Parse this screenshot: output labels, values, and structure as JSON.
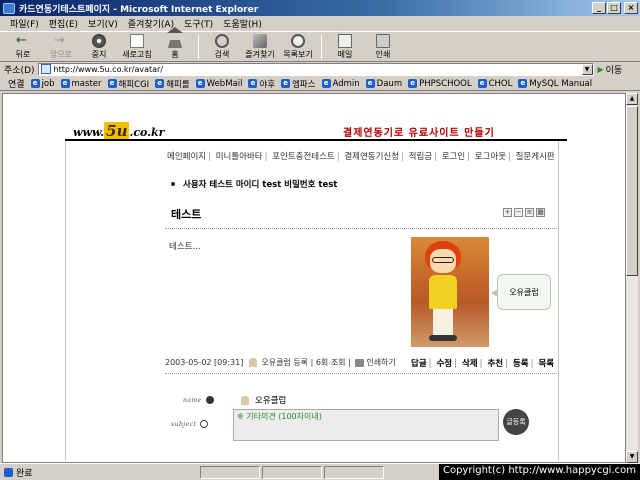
{
  "window": {
    "title": "카드연동기테스트페이지 - Microsoft Internet Explorer",
    "controls": {
      "minimize": "_",
      "maximize": "□",
      "close": "×"
    }
  },
  "menu": [
    "파일(F)",
    "편집(E)",
    "보기(V)",
    "즐겨찾기(A)",
    "도구(T)",
    "도움말(H)"
  ],
  "toolbar": {
    "back": "뒤로",
    "forward": "앞으로",
    "stop": "중지",
    "refresh": "새로고침",
    "home": "홈",
    "search": "검색",
    "favorites": "즐겨찾기",
    "history": "목록보기",
    "mail": "메일",
    "print": "인쇄"
  },
  "address": {
    "label": "주소(D)",
    "url": "http://www.5u.co.kr/avatar/",
    "go": "이동"
  },
  "links": {
    "label": "연결",
    "items": [
      "job",
      "master",
      "해피CGI",
      "해피롤",
      "WebMail",
      "야후",
      "엠파스",
      "Admin",
      "Daum",
      "PHPSCHOOL",
      "CHOL",
      "MySQL Manual"
    ]
  },
  "site": {
    "logo_prefix": "www.",
    "logo_main": "5u",
    "logo_suffix": ".co.kr",
    "slogan": "결제연동기로 유료사이트 만들기",
    "nav": [
      "메인페이지",
      "미니툴아바타",
      "포인트충전테스트",
      "결제연동기신청",
      "적립금",
      "로그인",
      "로그아웃",
      "질문게시판"
    ],
    "profile_line": "사용자 테스트 마이디 test 비밀번호 test"
  },
  "post": {
    "title": "테스트",
    "tools": [
      "+",
      "−",
      "≡",
      "▦"
    ],
    "body": "테스트...",
    "speech": "오유클럽",
    "date": "2003-05-02 [09:31]",
    "author": "오유클럽 등록",
    "views": "6회 조회",
    "print": "인쇄하기",
    "actions": [
      "답글",
      "수정",
      "삭제",
      "추천",
      "등록",
      "목록"
    ]
  },
  "comment": {
    "name_label": "name",
    "subject_label": "subject",
    "name_value": "오유클럽",
    "textarea_placeholder": "※ 기타의견 (100자이내)",
    "submit": "글등록"
  },
  "status": {
    "text": "완료",
    "copyright": "Copyright(c) http://www.happycgi.com"
  }
}
